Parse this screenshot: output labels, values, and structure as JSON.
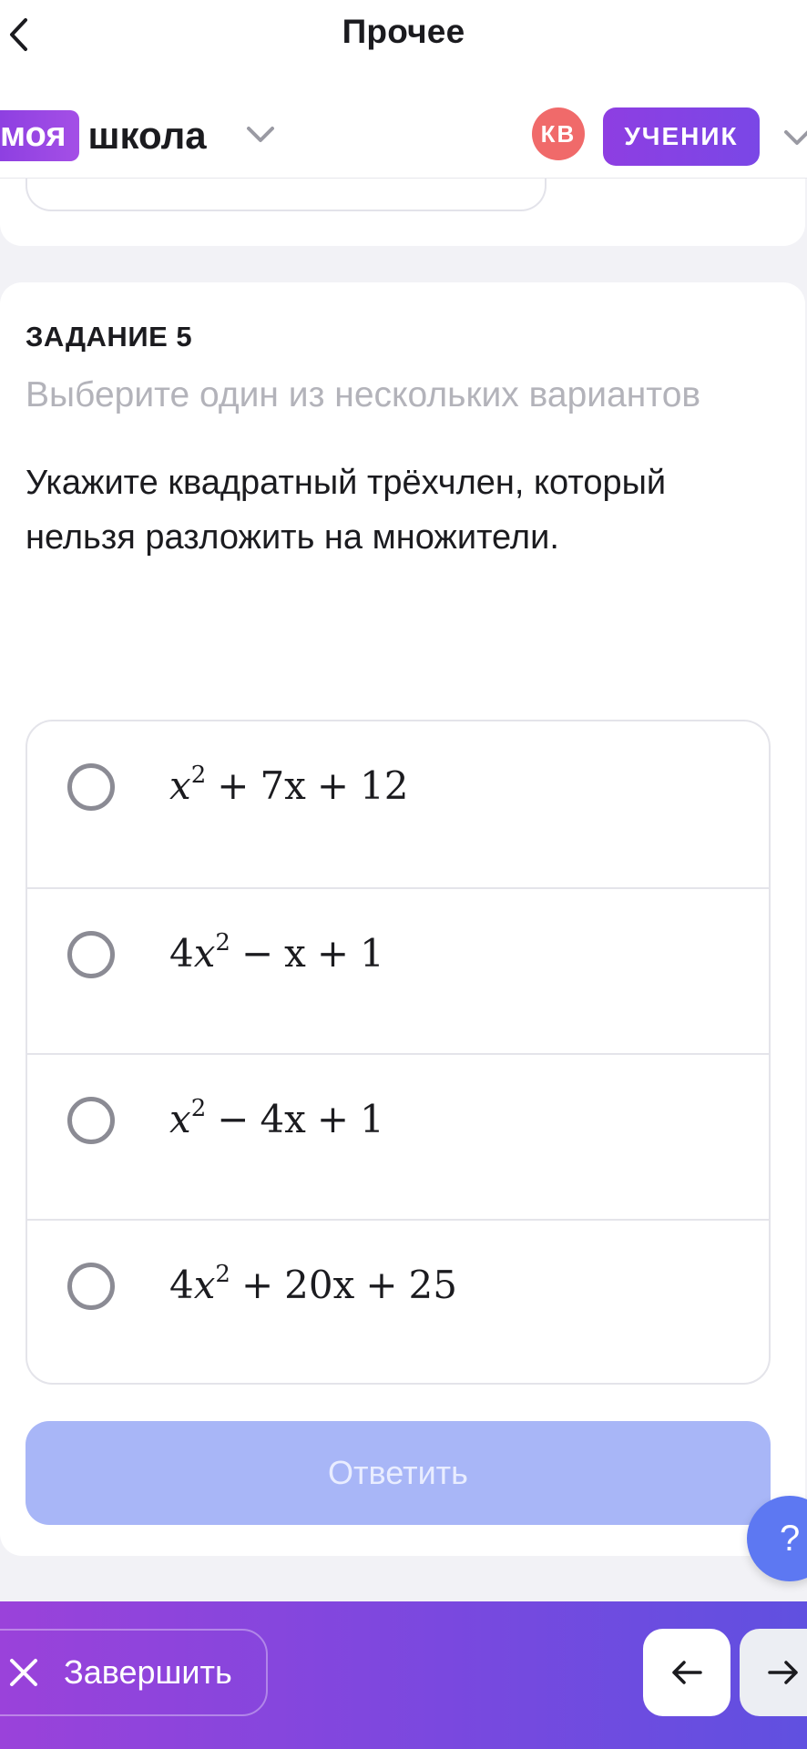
{
  "topnav": {
    "title": "Прочее",
    "back_icon": "chevron-left-icon"
  },
  "school": {
    "logo_badge": "моя",
    "logo_text": "школа",
    "avatar_initials": "КВ",
    "role": "УЧЕНИК"
  },
  "task": {
    "number": "ЗАДАНИЕ 5",
    "hint": "Выберите один из нескольких вариантов",
    "question": "Укажите квадратный трёхчлен, который нельзя разложить на множители.",
    "options": [
      {
        "coef": "",
        "var": "x",
        "exp": "2",
        "op1": "+",
        "term2": "7x",
        "op2": "+",
        "term3": "12",
        "selected": false
      },
      {
        "coef": "4",
        "var": "x",
        "exp": "2",
        "op1": "−",
        "term2": "x",
        "op2": "+",
        "term3": "1",
        "selected": false
      },
      {
        "coef": "",
        "var": "x",
        "exp": "2",
        "op1": "−",
        "term2": "4x",
        "op2": "+",
        "term3": "1",
        "selected": false
      },
      {
        "coef": "4",
        "var": "x",
        "exp": "2",
        "op1": "+",
        "term2": "20x",
        "op2": "+",
        "term3": "25",
        "selected": false
      }
    ],
    "answer_label": "Ответить"
  },
  "help": {
    "label": "?"
  },
  "bottom": {
    "finish_label": "Завершить",
    "prev_icon": "arrow-left-icon",
    "next_icon": "arrow-right-icon"
  },
  "colors": {
    "accent_purple": "#8e3ee2",
    "answer_disabled": "#a8b6f7",
    "help_blue": "#5d78f2",
    "avatar_red": "#f06a6a"
  }
}
